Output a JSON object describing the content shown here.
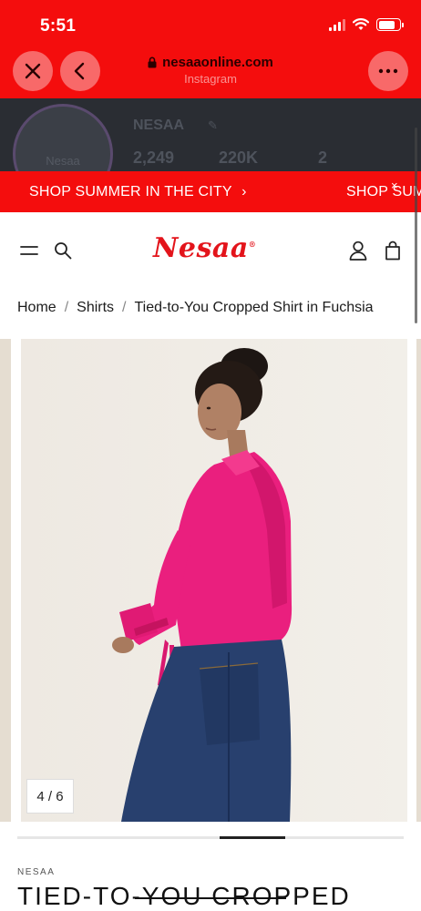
{
  "status_bar": {
    "time": "5:51",
    "battery_level": 0.8,
    "signal_bars": 4
  },
  "browser": {
    "domain": "nesaaonline.com",
    "source": "Instagram",
    "close_icon": "close-icon",
    "back_icon": "chevron-left-icon",
    "more_icon": "more-icon"
  },
  "instagram_profile": {
    "name": "NESAA",
    "avatar_text": "Nesaa",
    "stats": [
      "2,249",
      "220K",
      "2"
    ]
  },
  "promo": {
    "items": [
      "SHOP SUMMER IN THE CITY",
      "SHOP SUM"
    ],
    "chevron": "›",
    "close": "×"
  },
  "header": {
    "logo": "Nesaa",
    "logo_mark": "®",
    "icons": [
      "menu-icon",
      "search-icon",
      "account-icon",
      "cart-icon"
    ]
  },
  "breadcrumb": {
    "items": [
      "Home",
      "Shirts",
      "Tied-to-You Cropped Shirt in Fuchsia"
    ],
    "separator": "/"
  },
  "gallery": {
    "counter": "4 / 6",
    "current_index": 4,
    "total": 6,
    "progress_fraction": 0.17
  },
  "product": {
    "brand": "NESAA",
    "title": "TIED-TO-YOU CROPPED"
  },
  "colors": {
    "brand_red": "#f40d0d",
    "logo_red": "#e3141b",
    "shirt_fuchsia": "#ea1f7e",
    "denim": "#28406e"
  }
}
